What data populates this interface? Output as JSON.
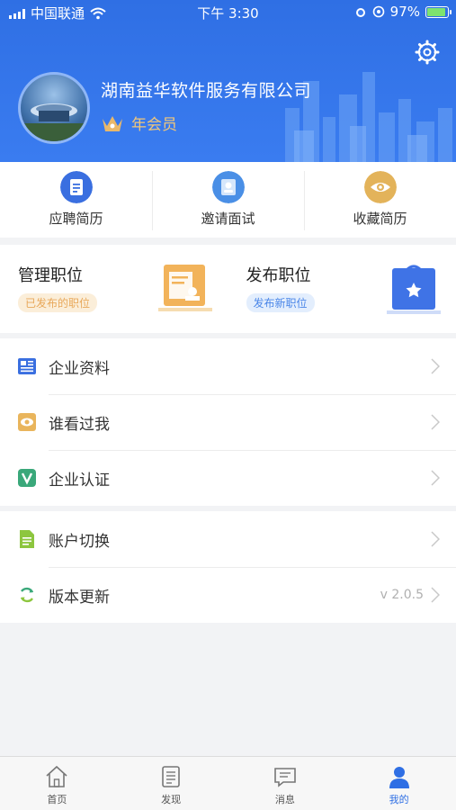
{
  "status_bar": {
    "carrier": "中国联通",
    "time": "下午 3:30",
    "battery": "97%"
  },
  "header": {
    "company_name": "湖南益华软件服务有限公司",
    "member_level": "年会员"
  },
  "quick_actions": [
    {
      "label": "应聘简历",
      "icon": "resume-icon",
      "color": "#3a6fe0"
    },
    {
      "label": "邀请面试",
      "icon": "interview-icon",
      "color": "#4a8fe6"
    },
    {
      "label": "收藏简历",
      "icon": "eye-icon",
      "color": "#e3b35a"
    }
  ],
  "jobs": {
    "manage": {
      "title": "管理职位",
      "tag": "已发布的职位",
      "tag_color": "#e8a85a"
    },
    "publish": {
      "title": "发布职位",
      "tag": "发布新职位",
      "tag_color": "#4a86e8"
    }
  },
  "menu_group_1": [
    {
      "label": "企业资料",
      "icon": "document-icon"
    },
    {
      "label": "谁看过我",
      "icon": "visitors-icon"
    },
    {
      "label": "企业认证",
      "icon": "verify-icon"
    }
  ],
  "menu_group_2": [
    {
      "label": "账户切换",
      "icon": "switch-account-icon",
      "right": ""
    },
    {
      "label": "版本更新",
      "icon": "refresh-icon",
      "right": "v 2.0.5"
    }
  ],
  "tab_bar": [
    {
      "label": "首页",
      "icon": "home-icon"
    },
    {
      "label": "发现",
      "icon": "discover-icon"
    },
    {
      "label": "消息",
      "icon": "message-icon"
    },
    {
      "label": "我的",
      "icon": "profile-icon",
      "active": true
    }
  ],
  "colors": {
    "primary": "#2f6fe4",
    "gold": "#f0c67a"
  }
}
